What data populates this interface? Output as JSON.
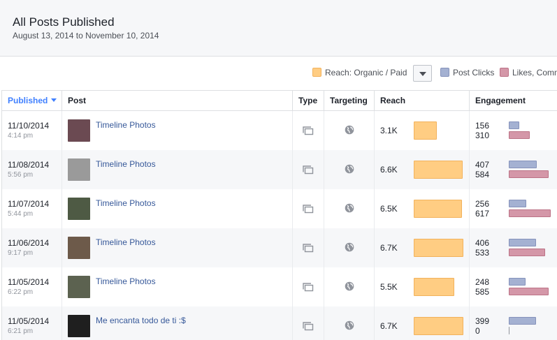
{
  "header": {
    "title": "All Posts Published",
    "date_range": "August 13, 2014 to November 10, 2014"
  },
  "legend": {
    "reach": {
      "label": "Reach: Organic / Paid",
      "color": "#ffcd83"
    },
    "clicks": {
      "label": "Post Clicks",
      "color": "#a4b1d2"
    },
    "likes": {
      "label": "Likes, Comm",
      "color": "#d497a8"
    },
    "dropdown_icon": "caret-down-icon"
  },
  "columns": {
    "published": "Published",
    "post": "Post",
    "type": "Type",
    "targeting": "Targeting",
    "reach": "Reach",
    "engagement": "Engagement"
  },
  "scale": {
    "reach_max": 6.7,
    "engagement_max": 617
  },
  "posts": [
    {
      "date": "11/10/2014",
      "time": "4:14 pm",
      "title": "Timeline Photos",
      "reach_label": "3.1K",
      "reach": 3.1,
      "clicks": 156,
      "likes": 310,
      "thumb": "#6b4a52",
      "thumb_icon": "photo-thumbnail"
    },
    {
      "date": "11/08/2014",
      "time": "5:56 pm",
      "title": "Timeline Photos",
      "reach_label": "6.6K",
      "reach": 6.6,
      "clicks": 407,
      "likes": 584,
      "thumb": "#9a9a9a",
      "thumb_icon": "kitten-photo-thumbnail"
    },
    {
      "date": "11/07/2014",
      "time": "5:44 pm",
      "title": "Timeline Photos",
      "reach_label": "6.5K",
      "reach": 6.5,
      "clicks": 256,
      "likes": 617,
      "thumb": "#4e5a44",
      "thumb_icon": "photo-thumbnail"
    },
    {
      "date": "11/06/2014",
      "time": "9:17 pm",
      "title": "Timeline Photos",
      "reach_label": "6.7K",
      "reach": 6.7,
      "clicks": 406,
      "likes": 533,
      "thumb": "#6d5a4a",
      "thumb_icon": "photo-thumbnail"
    },
    {
      "date": "11/05/2014",
      "time": "6:22 pm",
      "title": "Timeline Photos",
      "reach_label": "5.5K",
      "reach": 5.5,
      "clicks": 248,
      "likes": 585,
      "thumb": "#5c6250",
      "thumb_icon": "photo-thumbnail"
    },
    {
      "date": "11/05/2014",
      "time": "6:21 pm",
      "title": "Me encanta todo de ti :$",
      "reach_label": "6.7K",
      "reach": 6.7,
      "clicks": 399,
      "likes": 0,
      "thumb": "#1f1f1f",
      "thumb_icon": "text-photo-thumbnail"
    }
  ],
  "icons": {
    "type": "album-type-icon",
    "targeting": "globe-icon"
  }
}
